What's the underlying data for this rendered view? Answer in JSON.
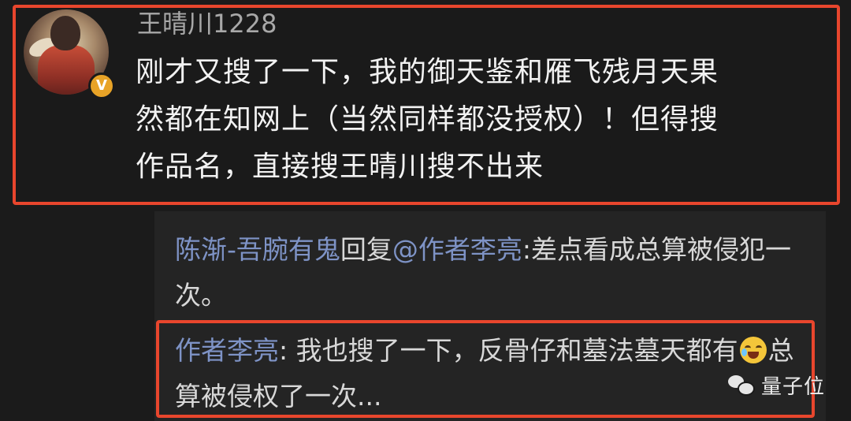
{
  "main_comment": {
    "username": "王晴川1228",
    "badge": "V",
    "lines": [
      "刚才又搜了一下，我的御天鉴和雁飞残月天果",
      "然都在知网上（当然同样都没授权）！但得搜",
      "作品名，直接搜王晴川搜不出来"
    ]
  },
  "replies": [
    {
      "author": "陈渐-吾腕有鬼",
      "connector": "回复",
      "target": "@作者李亮",
      "text": ":差点看成总算被侵犯一次。"
    },
    {
      "author": "作者李亮",
      "text_before_emoji": ": 我也搜了一下，反骨仔和墓法墓天都有",
      "emoji": "laugh-cry-emoji",
      "text_after_emoji": "总算被侵权了一次..."
    }
  ],
  "watermark": {
    "icon": "wechat-icon",
    "label": "量子位"
  },
  "colors": {
    "background": "#1b1b1b",
    "highlight_border": "#e8462d",
    "author_link": "#7e93c6",
    "badge": "#e8a327"
  }
}
